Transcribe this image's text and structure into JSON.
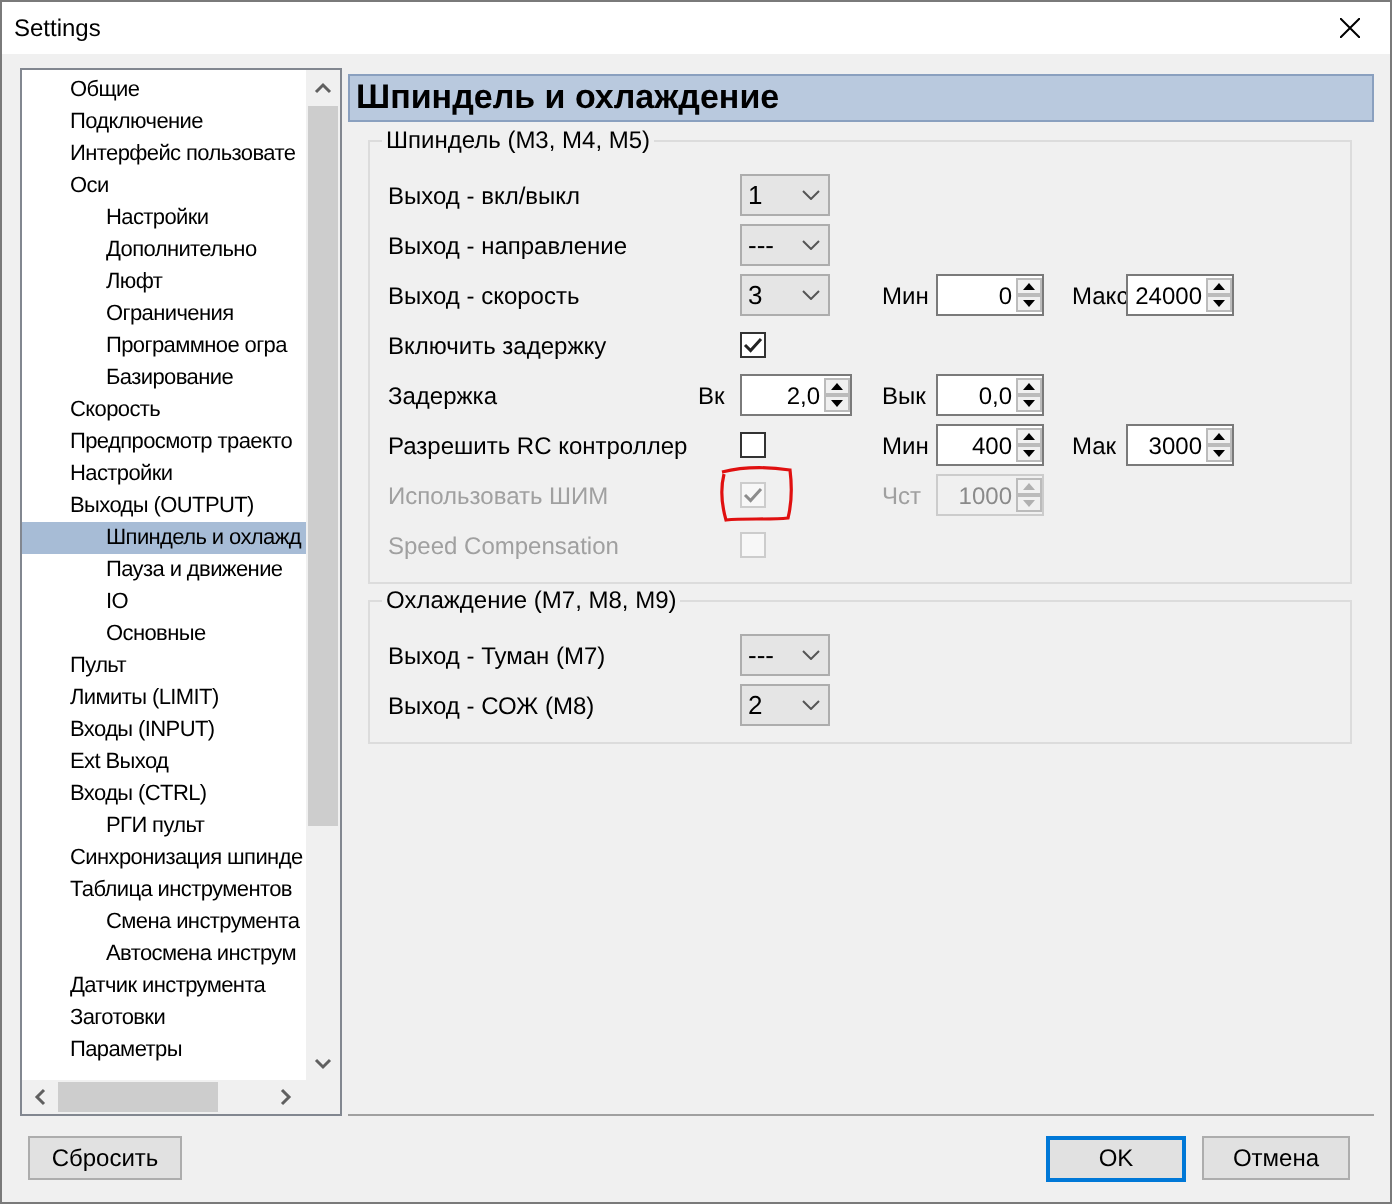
{
  "window": {
    "title": "Settings"
  },
  "tree": [
    {
      "label": "Общие",
      "selected": false
    },
    {
      "label": "Подключение",
      "selected": false
    },
    {
      "label": "Интерфейс пользовате",
      "selected": false
    },
    {
      "label": "Оси",
      "selected": false,
      "children": [
        {
          "label": "Настройки",
          "selected": false
        },
        {
          "label": "Дополнительно",
          "selected": false
        },
        {
          "label": "Люфт",
          "selected": false
        },
        {
          "label": "Ограничения",
          "selected": false
        },
        {
          "label": "Программное огра",
          "selected": false
        },
        {
          "label": "Базирование",
          "selected": false
        }
      ]
    },
    {
      "label": "Скорость",
      "selected": false
    },
    {
      "label": "Предпросмотр траекто",
      "selected": false
    },
    {
      "label": "Настройки",
      "selected": false
    },
    {
      "label": "Выходы (OUTPUT)",
      "selected": false,
      "children": [
        {
          "label": "Шпиндель и охлажд",
          "selected": true
        },
        {
          "label": "Пауза и движение",
          "selected": false
        },
        {
          "label": "IO",
          "selected": false
        },
        {
          "label": "Основные",
          "selected": false
        }
      ]
    },
    {
      "label": "Пульт",
      "selected": false
    },
    {
      "label": "Лимиты (LIMIT)",
      "selected": false
    },
    {
      "label": "Входы (INPUT)",
      "selected": false
    },
    {
      "label": "Ext Выход",
      "selected": false
    },
    {
      "label": "Входы (CTRL)",
      "selected": false,
      "children": [
        {
          "label": "РГИ пульт",
          "selected": false
        }
      ]
    },
    {
      "label": "Синхронизация шпинде",
      "selected": false
    },
    {
      "label": "Таблица инструментов",
      "selected": false,
      "children": [
        {
          "label": "Смена инструмента",
          "selected": false
        },
        {
          "label": "Автосмена инструм",
          "selected": false
        }
      ]
    },
    {
      "label": "Датчик инструмента",
      "selected": false
    },
    {
      "label": "Заготовки",
      "selected": false
    },
    {
      "label": "Параметры",
      "selected": false
    }
  ],
  "panel": {
    "title": "Шпиндель и охлаждение"
  },
  "groups": [
    {
      "title": "Шпиндель (M3, M4, M5)",
      "rows": [
        {
          "kind": "select",
          "label": "Выход - вкл/выкл",
          "value": "1"
        },
        {
          "kind": "select",
          "label": "Выход - направление",
          "value": "---"
        },
        {
          "kind": "select",
          "label": "Выход - скорость",
          "value": "3",
          "fields": [
            {
              "label": "Мин",
              "value": "0",
              "disabled": false
            },
            {
              "label": "Макс",
              "value": "24000",
              "disabled": false
            }
          ]
        },
        {
          "kind": "checkbox",
          "label": "Включить задержку",
          "checked": true,
          "disabled": false
        },
        {
          "kind": "spin",
          "label": "Задержка",
          "inner_label": "Вк",
          "value": "2,0",
          "fields": [
            {
              "label": "Вык",
              "value": "0,0",
              "disabled": false
            }
          ]
        },
        {
          "kind": "checkbox",
          "label": "Разрешить RC контроллер",
          "checked": false,
          "disabled": false,
          "fields": [
            {
              "label": "Мин",
              "value": "400",
              "disabled": false
            },
            {
              "label": "Мак",
              "value": "3000",
              "disabled": false
            }
          ]
        },
        {
          "kind": "checkbox",
          "label": "Использовать ШИМ",
          "checked": true,
          "disabled": true,
          "annotated": true,
          "fields": [
            {
              "label": "Чст",
              "value": "1000",
              "disabled": true
            }
          ]
        },
        {
          "kind": "checkbox",
          "label": "Speed Compensation",
          "checked": false,
          "disabled": true
        }
      ]
    },
    {
      "title": "Охлаждение (M7, M8, M9)",
      "rows": [
        {
          "kind": "select",
          "label": "Выход - Туман (M7)",
          "value": "---"
        },
        {
          "kind": "select",
          "label": "Выход - СОЖ (M8)",
          "value": "2"
        }
      ]
    }
  ],
  "buttons": {
    "reset": "Сбросить",
    "ok": "OK",
    "cancel": "Отмена"
  }
}
